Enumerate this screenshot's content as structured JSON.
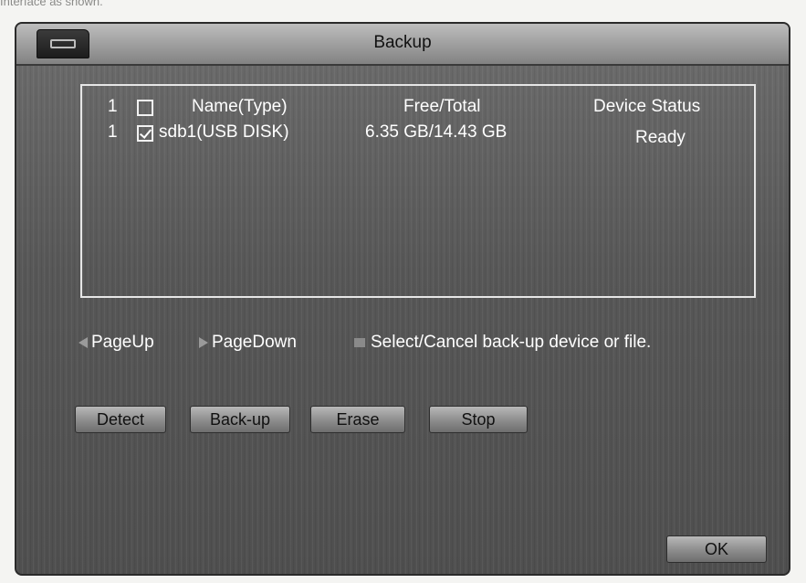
{
  "caption_top": "Interface as shown.",
  "caption_bottom": "",
  "window": {
    "title": "Backup",
    "icon": "backup-device-icon"
  },
  "device_list": {
    "header": {
      "index": "1",
      "checked": false,
      "name": "Name(Type)",
      "free_total": "Free/Total",
      "status": "Device Status"
    },
    "rows": [
      {
        "index": "1",
        "checked": true,
        "name": "sdb1(USB DISK)",
        "free_total": "6.35 GB/14.43 GB",
        "status": "Ready"
      }
    ]
  },
  "hints": {
    "page_up": "PageUp",
    "page_down": "PageDown",
    "select": "Select/Cancel back-up device or file."
  },
  "buttons": {
    "detect": "Detect",
    "backup": "Back-up",
    "erase": "Erase",
    "stop": "Stop",
    "ok": "OK"
  },
  "colors": {
    "panel_text": "#ffffff",
    "button_face": "#8c8c8c"
  }
}
